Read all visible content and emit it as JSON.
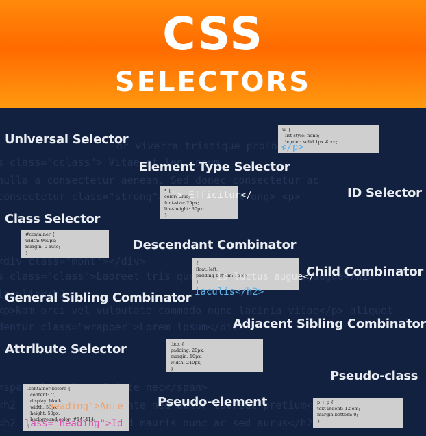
{
  "banner": {
    "title": "CSS",
    "subtitle": "SELECTORS"
  },
  "background_code": [
    "or viverra tristique proin</p>",
    "s class=\"cclass\"> Vitae et leo ipsum",
    "nulla a consectetur aenean. Sed donec consectetur ac",
    "consectetur class=\"strong\">Efficitur</strong> <p>",
    "<div class=\"mont\"></div>",
    "s class=\"class\">Laoreet tris quem sit </h2> luctus augue</h2>",
    "iaculis</h2>",
    "<p>Nam orci vel vulputate commodo nunc lacinia vitae</p> aliquet",
    "dentur class=\"wrapper\">Lorem ipsum</div>",
    "<span class=\"span\">Ante nec</span>",
    "<h2 class=\"heading\">Ante nec dolor laoreet pretium</h2>",
    "<h2 class=\"heading\">Id mauris nunc ac sed aurus</h2>"
  ],
  "labels": {
    "universal": "Universal Selector",
    "element_type": "Element Type Selector",
    "id": "ID Selector",
    "class": "Class Selector",
    "descendant": "Descendant Combinator",
    "child": "Child Combinator",
    "general_sibling": "General Sibling Combinator",
    "adjacent_sibling": "Adjacent Sibling Combinator",
    "attribute": "Attribute Selector",
    "pseudo_class": "Pseudo-class",
    "pseudo_element": "Pseudo-element"
  },
  "snippets": {
    "ul": "ul {\n  list-style: none;\n  border: solid 1px #ccc;\n}",
    "universal": "* {\ncolor: blue;\nfont-size: 25px;\nline-height: 30px;\n}",
    "container": "#container {\nwidth: 960px;\nmargin: 0 auto;\n}",
    "float": "{\nfloat: left;\npadding-bottom: 15px;\n}",
    "box": ".box {\npadding: 20px;\nmargin: 10px;\nwidth: 240px;\n}",
    "before": ".container:before {\n  content: \"\";\n  display: block;\n  width: 50px;\n  height: 50px;\n  background-color: #141414;\n}",
    "adjacent": "p + p {\ntext-indent: 1.5em;\nmargin-bottom: 0;\n}"
  },
  "overlays": {
    "p_close": "</p>",
    "efficitur": "\"> Efficitur</",
    "luctus": "is luctus augue</",
    "iaculis": "iaculis</h2>",
    "heading1": "heading\">Ante",
    "heading2": "lass=\"heading\">Id"
  },
  "colors": {
    "background": "#12213f",
    "banner_orange": "#ff7a00",
    "label_text": "#e9edf2",
    "snippet_bg": "#cfcfcf",
    "code_blue": "#5fb0e6",
    "code_pink": "#d94fb4",
    "code_string": "#f0a06a"
  }
}
